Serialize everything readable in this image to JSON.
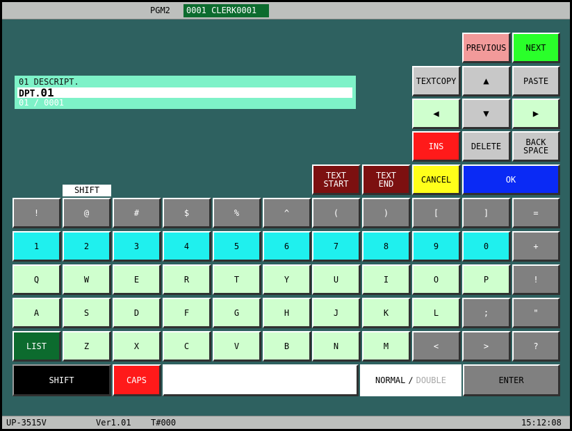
{
  "topbar": {
    "program": "PGM2",
    "clerk": "0001 CLERK0001"
  },
  "description": {
    "label": "01 DESCRIPT.",
    "value_prefix": "DPT.",
    "value_main": "01",
    "position": "01 ∕ 0001"
  },
  "edit_keys": {
    "previous": "PREVIOUS",
    "next": "NEXT",
    "textcopy": "TEXTCOPY",
    "up": "▲",
    "paste": "PASTE",
    "left": "◀",
    "down": "▼",
    "right": "▶",
    "ins": "INS",
    "delete": "DELETE",
    "backspace_1": "BACK",
    "backspace_2": "SPACE",
    "text_start_1": "TEXT",
    "text_start_2": "START",
    "text_end_1": "TEXT",
    "text_end_2": "END",
    "cancel": "CANCEL",
    "ok": "OK"
  },
  "shift_indicator": "SHIFT",
  "keyboard": {
    "row1": [
      "!",
      "@",
      "#",
      "$",
      "%",
      "^",
      "(",
      ")",
      "[",
      "]",
      "="
    ],
    "row2": [
      "1",
      "2",
      "3",
      "4",
      "5",
      "6",
      "7",
      "8",
      "9",
      "0",
      "+"
    ],
    "row3": [
      "Q",
      "W",
      "E",
      "R",
      "T",
      "Y",
      "U",
      "I",
      "O",
      "P",
      "!"
    ],
    "row4": [
      "A",
      "S",
      "D",
      "F",
      "G",
      "H",
      "J",
      "K",
      "L",
      ";",
      "\""
    ],
    "row5": [
      "LIST",
      "Z",
      "X",
      "C",
      "V",
      "B",
      "N",
      "M",
      "<",
      ">",
      "?"
    ]
  },
  "bottom": {
    "shift": "SHIFT",
    "caps": "CAPS",
    "entry_value": "",
    "mode_normal": "NORMAL",
    "mode_sep": "∕",
    "mode_double": "DOUBLE",
    "enter": "ENTER"
  },
  "status": {
    "model": "UP-3515V",
    "version": "Ver1.01",
    "terminal": "T#000",
    "time": "15:12:08"
  },
  "colors": {
    "background": "#2e6160",
    "key_green": "#cfffce",
    "key_cyan": "#1ff0ee",
    "key_gray": "#808080",
    "ok_blue": "#0a2af5",
    "ins_red": "#ff1a1a",
    "cancel_yellow": "#ffff1a",
    "next_lime": "#2aff2a",
    "previous_pink": "#f29a9a",
    "text_maroon": "#7c1010"
  }
}
